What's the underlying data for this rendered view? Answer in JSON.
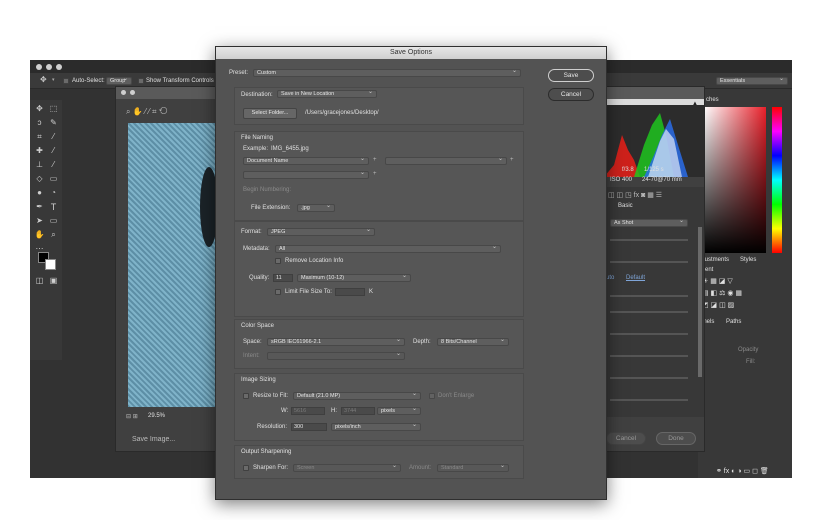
{
  "ps": {
    "options_bar": {
      "auto_select_label": "Auto-Select:",
      "auto_select_value": "Group",
      "show_transform_label": "Show Transform Controls"
    },
    "workspace": "Essentials",
    "panels": {
      "swatches_tab": "ches",
      "adjustments_tab": "djustments",
      "styles_tab": "Styles",
      "adjustments_subtitle": "ment",
      "channels_tab": "nnels",
      "paths_tab": "Paths",
      "opacity_label": "Opacity",
      "fill_label": "Fill:"
    }
  },
  "raw": {
    "zoom": "29.5%",
    "save_image_label": "Save Image...",
    "cancel_label": "Cancel",
    "done_label": "Done",
    "camera_info": {
      "aperture": "f/3.8",
      "shutter": "1/125 s",
      "iso": "ISO 400",
      "lens": "24-70@70 mm"
    },
    "basic_label": "Basic",
    "wb_value": "As Shot",
    "auto_label": "uto",
    "default_label": "Default"
  },
  "dialog": {
    "title": "Save Options",
    "preset_label": "Preset:",
    "preset_value": "Custom",
    "save_button": "Save",
    "cancel_button": "Cancel",
    "destination": {
      "label": "Destination:",
      "value": "Save in New Location",
      "select_folder": "Select Folder...",
      "path": "/Users/gracejones/Desktop/"
    },
    "file_naming": {
      "title": "File Naming",
      "example_label": "Example:",
      "example_value": "IMG_6455.jpg",
      "field1": "Document Name",
      "begin_numbering": "Begin Numbering:",
      "ext_label": "File Extension:",
      "ext_value": ".jpg"
    },
    "format": {
      "label": "Format:",
      "value": "JPEG",
      "metadata_label": "Metadata:",
      "metadata_value": "All",
      "remove_location": "Remove Location Info",
      "quality_label": "Quality:",
      "quality_value": "11",
      "quality_desc": "Maximum  (10-12)",
      "limit_label": "Limit File Size To:",
      "limit_unit": "K"
    },
    "color_space": {
      "title": "Color Space",
      "space_label": "Space:",
      "space_value": "sRGB IEC61966-2.1",
      "depth_label": "Depth:",
      "depth_value": "8 Bits/Channel",
      "intent_label": "Intent:"
    },
    "image_sizing": {
      "title": "Image Sizing",
      "resize_label": "Resize to Fit:",
      "resize_value": "Default  (21.0 MP)",
      "dont_enlarge": "Don't Enlarge",
      "w_label": "W:",
      "w_value": "5616",
      "h_label": "H:",
      "h_value": "3744",
      "units": "pixels",
      "resolution_label": "Resolution:",
      "resolution_value": "300",
      "resolution_units": "pixels/inch"
    },
    "output_sharpening": {
      "title": "Output Sharpening",
      "sharpen_label": "Sharpen For:",
      "sharpen_value": "Screen",
      "amount_label": "Amount:",
      "amount_value": "Standard"
    }
  }
}
